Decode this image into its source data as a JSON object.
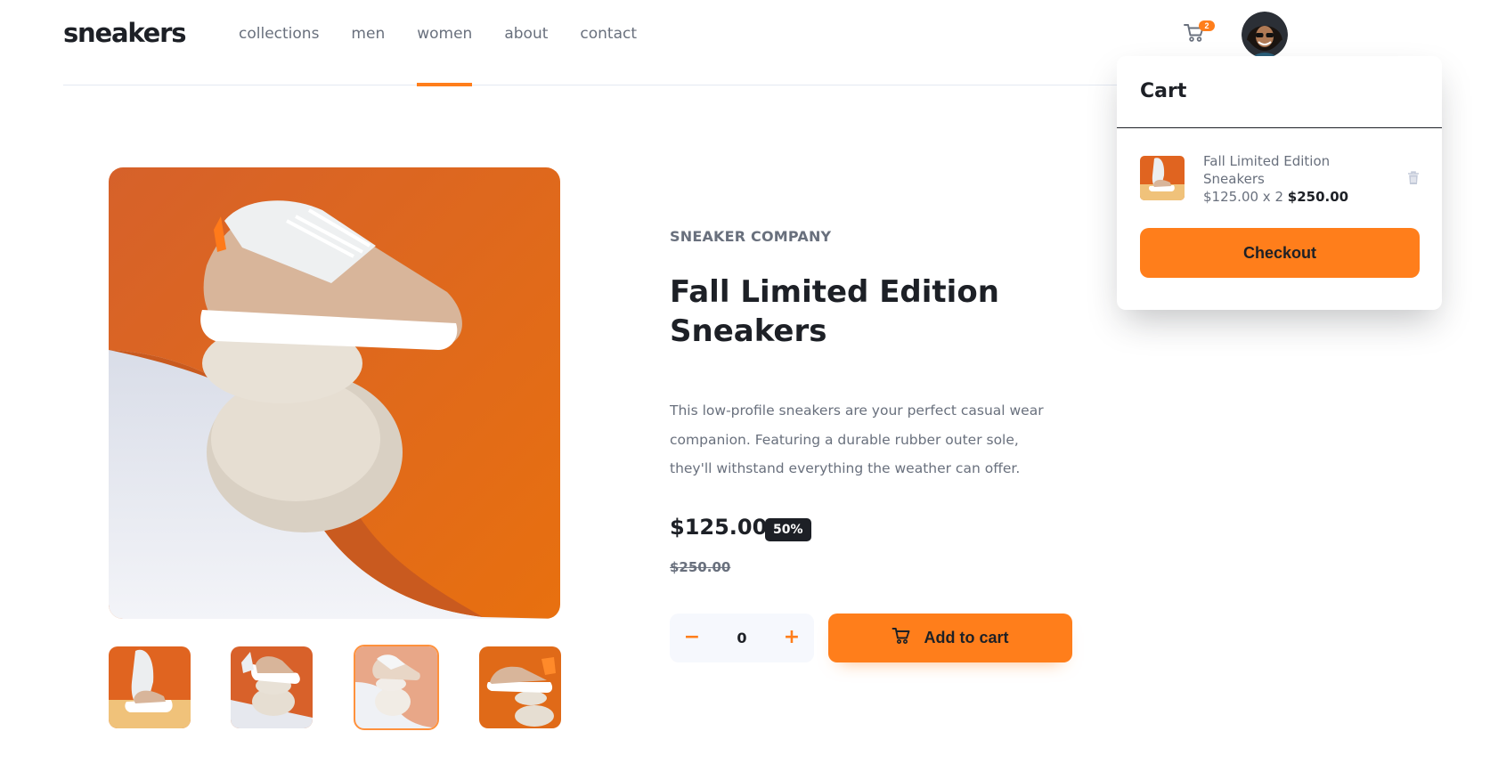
{
  "header": {
    "logo": "sneakers",
    "nav": [
      "collections",
      "men",
      "women",
      "about",
      "contact"
    ],
    "active_nav": "women",
    "cart_count": "2"
  },
  "product": {
    "brand": "SNEAKER COMPANY",
    "title": "Fall Limited Edition Sneakers",
    "description": "This low-profile sneakers are your perfect casual wear companion. Featuring a durable rubber outer sole, they'll withstand everything the weather can offer.",
    "price": "$125.00",
    "discount": "50%",
    "original_price": "$250.00",
    "quantity": "0",
    "qty_minus": "−",
    "qty_plus": "+",
    "add_to_cart_label": "Add to cart"
  },
  "gallery": {
    "thumbnail_count": 4,
    "active_thumbnail": 3
  },
  "cart": {
    "title": "Cart",
    "item_name": "Fall Limited Edition Sneakers",
    "item_price_qty": "$125.00 x 2",
    "item_total": "$250.00",
    "checkout_label": "Checkout"
  },
  "colors": {
    "accent": "#ff7e1b",
    "dark": "#1d2026",
    "muted": "#69707d",
    "light_bg": "#f6f8fd"
  },
  "icons": [
    "cart-icon",
    "avatar",
    "minus-icon",
    "plus-icon",
    "trash-icon"
  ]
}
